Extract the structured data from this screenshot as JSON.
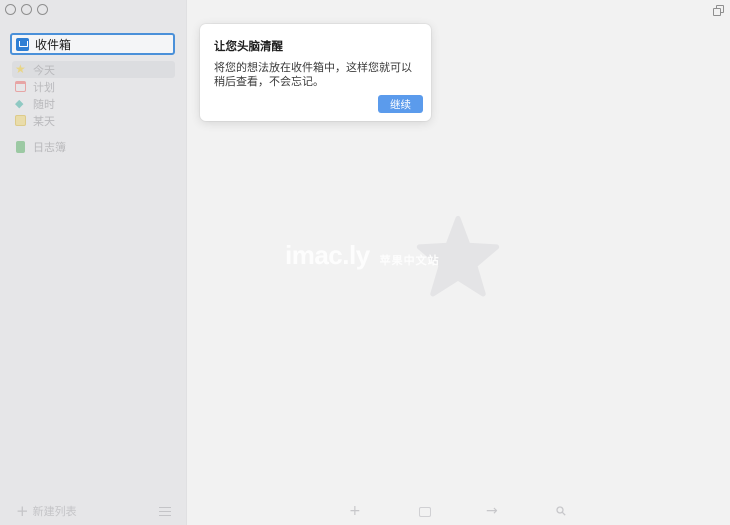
{
  "sidebar": {
    "inbox_label": "收件箱",
    "items": [
      {
        "label": "今天",
        "icon": "star-icon"
      },
      {
        "label": "计划",
        "icon": "calendar-icon"
      },
      {
        "label": "随时",
        "icon": "layers-icon"
      },
      {
        "label": "某天",
        "icon": "box-icon"
      }
    ],
    "logbook_label": "日志簿",
    "new_list_label": "新建列表"
  },
  "popover": {
    "title": "让您头脑清醒",
    "text": "将您的想法放在收件箱中，这样您就可以稍后查看，不会忘记。",
    "continue_label": "继续"
  },
  "watermark": {
    "main": "imac.ly",
    "sub": "苹果中文站"
  },
  "colors": {
    "accent": "#4a90d9",
    "button": "#5b9bec",
    "sidebar_bg": "#e6e6e8",
    "main_bg": "#f2f2f2"
  }
}
